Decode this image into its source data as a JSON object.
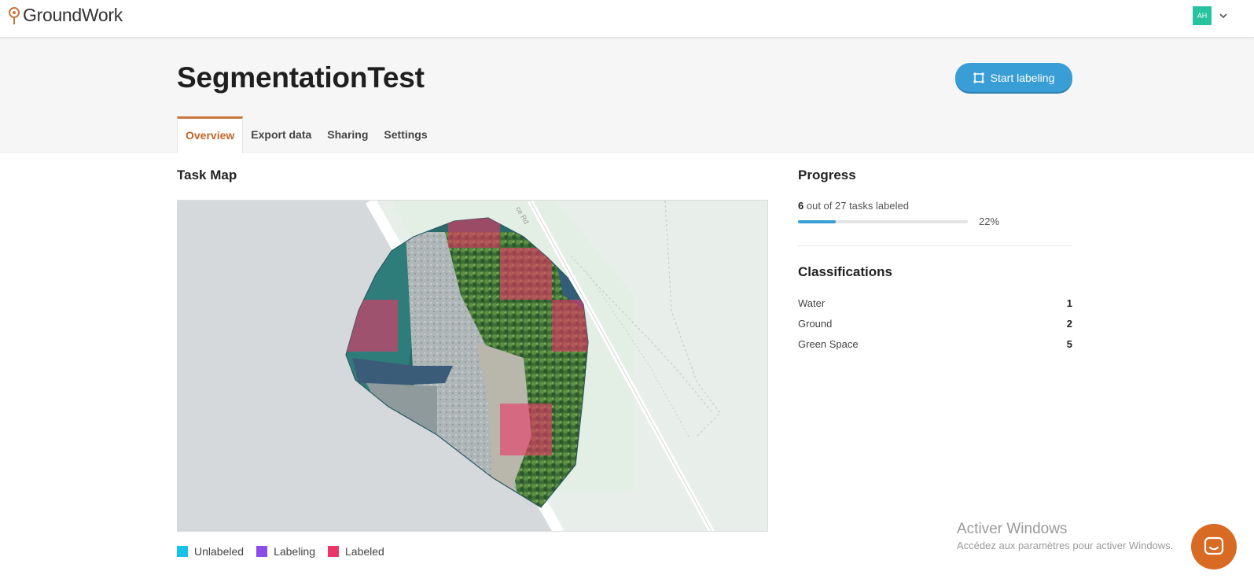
{
  "app": {
    "name": "GroundWork"
  },
  "user": {
    "initials": "AH"
  },
  "project": {
    "title": "SegmentationTest",
    "start_button": "Start labeling"
  },
  "tabs": [
    {
      "label": "Overview",
      "active": true
    },
    {
      "label": "Export data",
      "active": false
    },
    {
      "label": "Sharing",
      "active": false
    },
    {
      "label": "Settings",
      "active": false
    }
  ],
  "task_map": {
    "title": "Task Map",
    "road_label": "ce Rd",
    "legend": [
      {
        "label": "Unlabeled",
        "color": "#17c1e8"
      },
      {
        "label": "Labeling",
        "color": "#8b4de8"
      },
      {
        "label": "Labeled",
        "color": "#ea3566"
      }
    ]
  },
  "progress": {
    "title": "Progress",
    "labeled": "6",
    "rest": "out of 27 tasks labeled",
    "fraction": 0.22,
    "percent_text": "22%"
  },
  "classifications": {
    "title": "Classifications",
    "items": [
      {
        "name": "Water",
        "count": "1"
      },
      {
        "name": "Ground",
        "count": "2"
      },
      {
        "name": "Green Space",
        "count": "5"
      }
    ]
  },
  "watermark": {
    "line1": "Activer Windows",
    "line2": "Accédez aux paramètres pour activer Windows."
  },
  "colors": {
    "accent": "#3a9ed6",
    "tab_active": "#c0652a",
    "chat": "#d96a24",
    "avatar": "#27c3a0"
  }
}
